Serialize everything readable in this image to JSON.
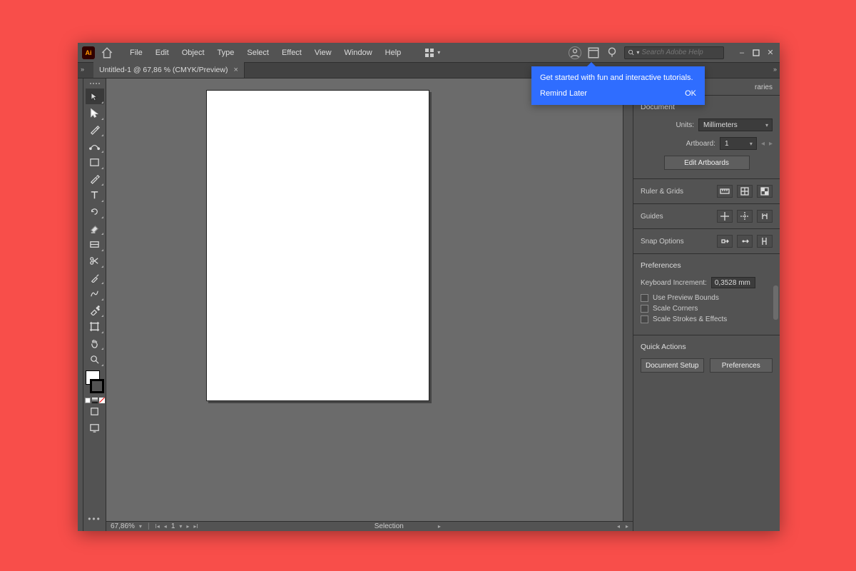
{
  "menubar": {
    "items": [
      "File",
      "Edit",
      "Object",
      "Type",
      "Select",
      "Effect",
      "View",
      "Window",
      "Help"
    ],
    "search_placeholder": "Search Adobe Help"
  },
  "document_tab": {
    "title": "Untitled-1 @ 67,86 % (CMYK/Preview)"
  },
  "tooltip": {
    "message": "Get started with fun and interactive tutorials.",
    "remind": "Remind Later",
    "ok": "OK"
  },
  "status_bar": {
    "zoom": "67,86%",
    "page": "1",
    "tool_readout": "Selection"
  },
  "properties": {
    "tab_label": "raries",
    "document": {
      "title": "Document",
      "units_label": "Units:",
      "units_value": "Millimeters",
      "artboard_label": "Artboard:",
      "artboard_value": "1",
      "edit_btn": "Edit Artboards"
    },
    "ruler_grids": {
      "title": "Ruler & Grids"
    },
    "guides": {
      "title": "Guides"
    },
    "snap": {
      "title": "Snap Options"
    },
    "prefs": {
      "title": "Preferences",
      "keyboard_increment_label": "Keyboard Increment:",
      "keyboard_increment_value": "0,3528 mm",
      "use_preview_bounds": "Use Preview Bounds",
      "scale_corners": "Scale Corners",
      "scale_strokes": "Scale Strokes & Effects"
    },
    "quick_actions": {
      "title": "Quick Actions",
      "doc_setup": "Document Setup",
      "prefs_btn": "Preferences"
    }
  },
  "tool_names": [
    "selection",
    "direct-selection",
    "pen",
    "curvature",
    "rectangle",
    "paintbrush",
    "type",
    "rotate",
    "eraser",
    "gradient",
    "scissors",
    "eyedropper",
    "blend",
    "symbol-sprayer",
    "artboard",
    "hand",
    "zoom"
  ]
}
